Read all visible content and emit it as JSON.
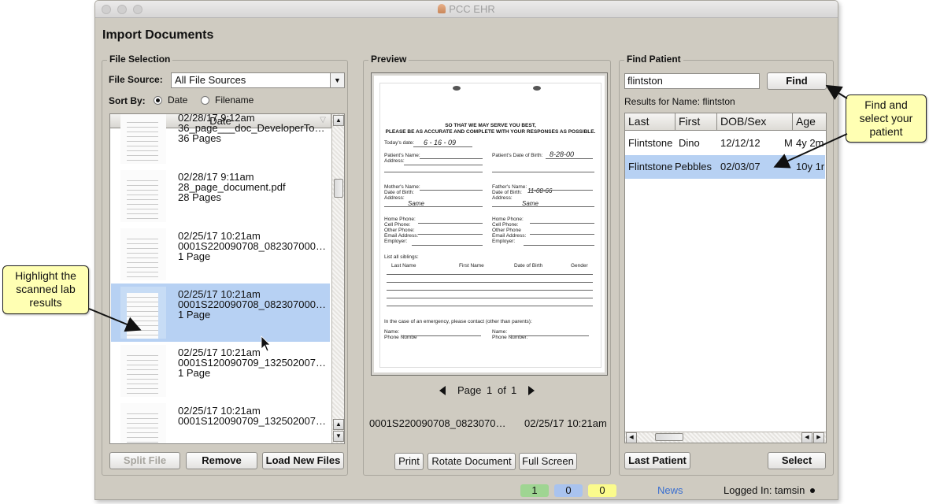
{
  "window": {
    "title": "PCC EHR",
    "page_title": "Import Documents"
  },
  "file_selection": {
    "legend": "File Selection",
    "file_source_label": "File Source:",
    "file_source_value": "All File Sources",
    "sort_by_label": "Sort By:",
    "sort_options": [
      {
        "label": "Date",
        "selected": true
      },
      {
        "label": "Filename",
        "selected": false
      }
    ],
    "column_header": "Date",
    "items": [
      {
        "date": "02/28/17 9:12am",
        "name": "36_page___doc_DeveloperTo…",
        "pages": "36 Pages",
        "selected": false
      },
      {
        "date": "02/28/17 9:11am",
        "name": "28_page_document.pdf",
        "pages": "28 Pages",
        "selected": false
      },
      {
        "date": "02/25/17 10:21am",
        "name": "0001S220090708_082307000…",
        "pages": "1 Page",
        "selected": false
      },
      {
        "date": "02/25/17 10:21am",
        "name": "0001S220090708_082307000…",
        "pages": "1 Page",
        "selected": true
      },
      {
        "date": "02/25/17 10:21am",
        "name": "0001S120090709_132502007…",
        "pages": "1 Page",
        "selected": false
      },
      {
        "date": "02/25/17 10:21am",
        "name": "0001S120090709_132502007…",
        "pages": "",
        "selected": false
      }
    ],
    "buttons": {
      "split": "Split File",
      "remove": "Remove",
      "load": "Load New Files"
    }
  },
  "preview": {
    "legend": "Preview",
    "doc": {
      "heading1": "SO THAT WE MAY SERVE YOU BEST,",
      "heading2": "PLEASE BE AS ACCURATE AND COMPLETE WITH YOUR RESPONSES AS POSSIBLE.",
      "todays_date": "Today's date:",
      "todays_date_value": "6 - 16 - 09",
      "patient_name": "Patient's Name:",
      "address": "Address:",
      "patient_dob": "Patient's Date of Birth:",
      "patient_dob_value": "8-28-00",
      "mothers_name": "Mother's Name:",
      "fathers_name": "Father's Name:",
      "date_of_birth": "Date of Birth:",
      "father_dob_value": "11-08-66",
      "same": "Same",
      "home_phone": "Home Phone:",
      "cell_phone": "Cell Phone:",
      "other_phone": "Other Phone:",
      "other_phone_2": "Other Phone",
      "email": "Email Address:",
      "employer": "Employer:",
      "list_siblings": "List all siblings:",
      "last_name": "Last Name",
      "first_name": "First Name",
      "dob": "Date of Birth",
      "gender": "Gender",
      "emergency": "In the case of an emergency, please contact (other than parents):",
      "name": "Name:",
      "phone_number": "Phone Numbe",
      "phone_number_2": "Phone Number:"
    },
    "page_label": "Page",
    "page_current": "1",
    "page_of": "of",
    "page_total": "1",
    "filename": "0001S220090708_0823070…",
    "filedate": "02/25/17 10:21am",
    "buttons": {
      "print": "Print",
      "rotate": "Rotate Document",
      "fullscreen": "Full Screen"
    }
  },
  "find_patient": {
    "legend": "Find Patient",
    "search_value": "flintston",
    "find_button": "Find",
    "results_label": "Results for Name: flintston",
    "columns": [
      "Last",
      "First",
      "DOB/Sex",
      "Age"
    ],
    "rows": [
      {
        "last": "Flintstone",
        "first": "Dino",
        "dob": "12/12/12",
        "sex": "M",
        "age": "4y 2m",
        "selected": false
      },
      {
        "last": "Flintstone",
        "first": "Pebbles",
        "dob": "02/03/07",
        "sex": "",
        "age": "10y 1r",
        "selected": true
      }
    ],
    "buttons": {
      "last_patient": "Last Patient",
      "select": "Select"
    }
  },
  "status_bar": {
    "green_count": "1",
    "blue_count": "0",
    "yellow_count": "0",
    "news": "News",
    "logged_in": "Logged In: tamsin",
    "colors": {
      "green": "#9fd592",
      "blue": "#a9c3ee",
      "yellow": "#fbfb8c"
    }
  },
  "callouts": {
    "left": [
      "Highlight the",
      "scanned lab",
      "results"
    ],
    "right": [
      "Find and",
      "select your",
      "patient"
    ]
  }
}
